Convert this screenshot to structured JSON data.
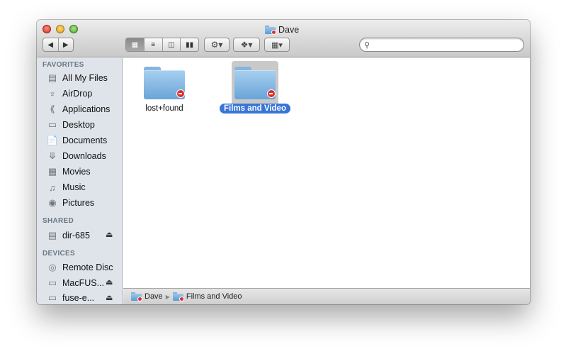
{
  "window": {
    "title": "Dave"
  },
  "toolbar": {
    "back_icon": "back-arrow-icon",
    "forward_icon": "forward-arrow-icon",
    "view_icons": [
      "icon-view-icon",
      "list-view-icon",
      "column-view-icon",
      "coverflow-view-icon"
    ],
    "action_icon": "gear-icon",
    "dropbox_icon": "dropbox-icon",
    "arrange_icon": "arrange-icon",
    "search": {
      "value": "",
      "placeholder": ""
    }
  },
  "sidebar": {
    "favorites_header": "FAVORITES",
    "favorites": [
      {
        "label": "All My Files",
        "icon": "all-files-icon"
      },
      {
        "label": "AirDrop",
        "icon": "airdrop-icon"
      },
      {
        "label": "Applications",
        "icon": "applications-icon"
      },
      {
        "label": "Desktop",
        "icon": "desktop-icon"
      },
      {
        "label": "Documents",
        "icon": "documents-icon"
      },
      {
        "label": "Downloads",
        "icon": "downloads-icon"
      },
      {
        "label": "Movies",
        "icon": "movies-icon"
      },
      {
        "label": "Music",
        "icon": "music-icon"
      },
      {
        "label": "Pictures",
        "icon": "pictures-icon"
      }
    ],
    "shared_header": "SHARED",
    "shared": [
      {
        "label": "dir-685",
        "icon": "network-computer-icon",
        "eject": true
      }
    ],
    "devices_header": "DEVICES",
    "devices": [
      {
        "label": "Remote Disc",
        "icon": "remote-disc-icon",
        "eject": false
      },
      {
        "label": "MacFUS...",
        "icon": "drive-icon",
        "eject": true
      },
      {
        "label": "fuse-e...",
        "icon": "drive-icon",
        "eject": true
      }
    ]
  },
  "content": {
    "items": [
      {
        "name": "lost+found",
        "selected": false
      },
      {
        "name": "Films and Video",
        "selected": true
      }
    ]
  },
  "pathbar": {
    "segments": [
      "Dave",
      "Films and Video"
    ]
  }
}
